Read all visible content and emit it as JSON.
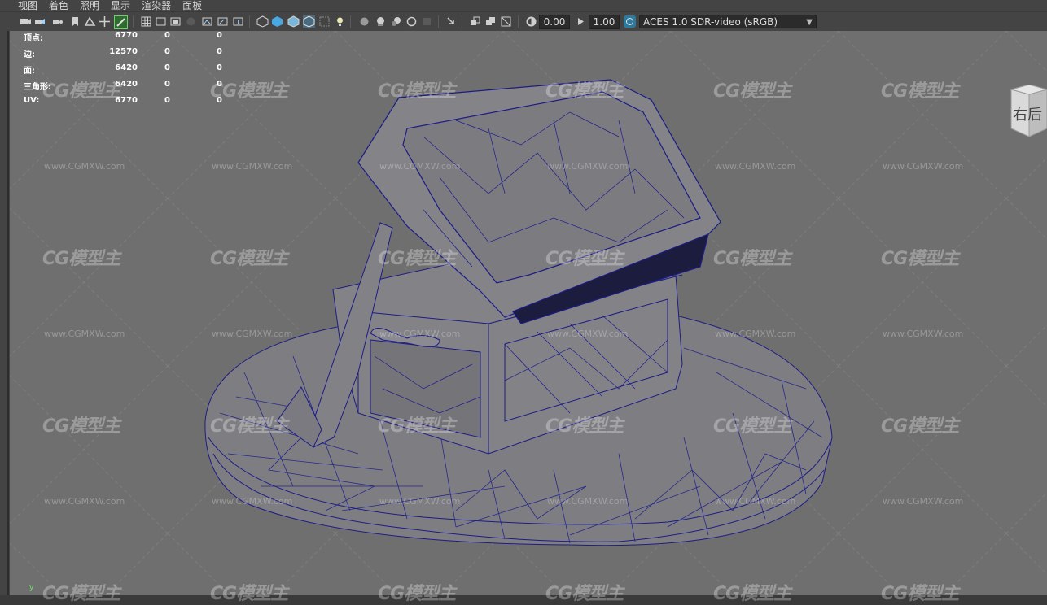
{
  "menu": [
    "视图",
    "着色",
    "照明",
    "显示",
    "渲染器",
    "面板"
  ],
  "toolbar": {
    "exposure_value": "0.00",
    "gamma_value": "1.00",
    "color_space": "ACES 1.0 SDR-video (sRGB)",
    "icons": [
      "camera-icon",
      "camera-attr-icon",
      "bookmark-icon",
      "image-plane-icon",
      "move-icon",
      "grease-pencil-icon",
      "grid-icon",
      "film-gate-icon",
      "resolution-gate-icon",
      "gate-mask-icon",
      "field-chart-icon",
      "safe-action-icon",
      "safe-title-icon",
      "wireframe-icon",
      "smooth-shade-icon",
      "wireframe-on-shaded-icon",
      "textured-icon",
      "lights-icon",
      "shadows-icon",
      "ambient-occlusion-icon",
      "motion-blur-icon",
      "anti-alias-icon",
      "depth-of-field-icon",
      "isolate-select-icon",
      "xray-icon",
      "xray-joints-icon",
      "backface-icon",
      "exposure-icon",
      "gamma-icon",
      "color-management-icon"
    ]
  },
  "hud": {
    "rows": [
      {
        "label": "顶点:",
        "v1": "6770",
        "v2": "0",
        "v3": "0"
      },
      {
        "label": "边:",
        "v1": "12570",
        "v2": "0",
        "v3": "0"
      },
      {
        "label": "面:",
        "v1": "6420",
        "v2": "0",
        "v3": "0"
      },
      {
        "label": "三角形:",
        "v1": "6420",
        "v2": "0",
        "v3": "0"
      },
      {
        "label": "UV:",
        "v1": "6770",
        "v2": "0",
        "v3": "0"
      }
    ]
  },
  "viewcube": {
    "label": "右后"
  },
  "watermark": {
    "logo": "CG模型主",
    "url": "www.CGMXW.com"
  },
  "axis_label": "y",
  "colors": {
    "viewport_bg": "#6f6f6f",
    "wire": "#1a1a7a",
    "mesh_fill": "#7e7e82",
    "ui_bg": "#444444"
  }
}
